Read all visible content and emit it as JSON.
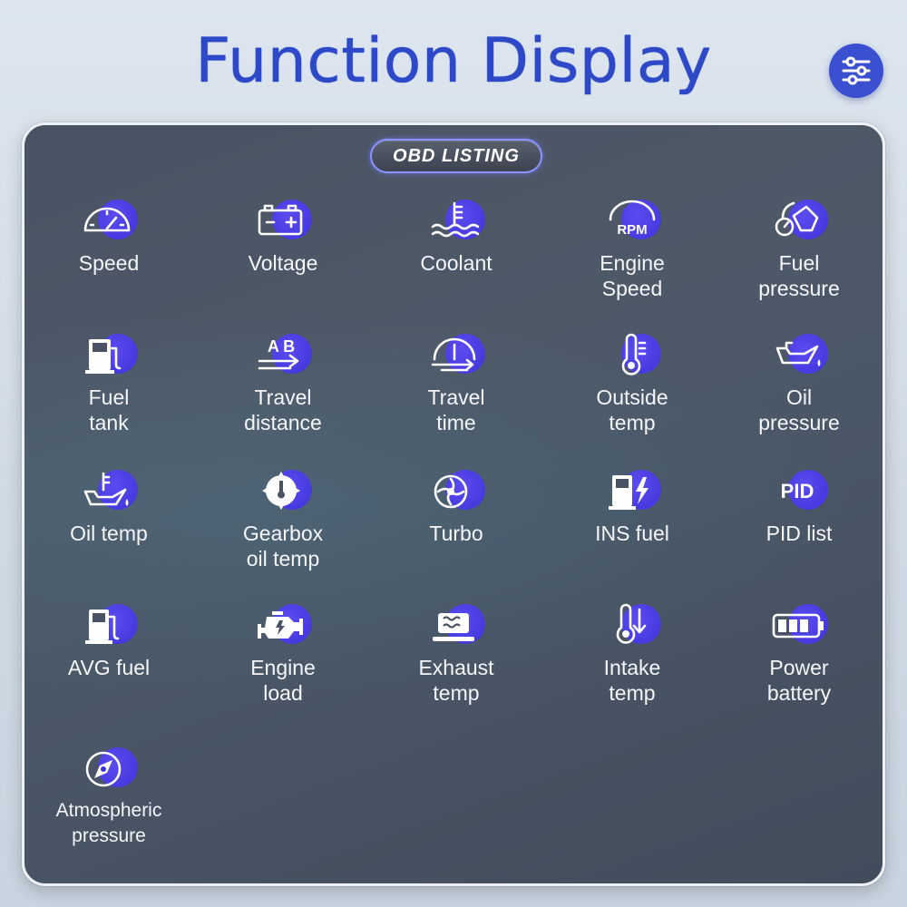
{
  "header": {
    "title": "Function Display"
  },
  "badge": {
    "label": "OBD LISTING"
  },
  "items": [
    {
      "label": "Speed",
      "icon": "speedometer-icon"
    },
    {
      "label": "Voltage",
      "icon": "battery-icon"
    },
    {
      "label": "Coolant",
      "icon": "coolant-icon"
    },
    {
      "label": "Engine\nSpeed",
      "icon": "rpm-icon"
    },
    {
      "label": "Fuel\npressure",
      "icon": "fuel-pressure-icon"
    },
    {
      "label": "Fuel\ntank",
      "icon": "fuel-pump-icon"
    },
    {
      "label": "Travel\ndistance",
      "icon": "distance-icon"
    },
    {
      "label": "Travel\ntime",
      "icon": "timer-icon"
    },
    {
      "label": "Outside\ntemp",
      "icon": "thermometer-icon"
    },
    {
      "label": "Oil\npressure",
      "icon": "oil-can-icon"
    },
    {
      "label": "Oil temp",
      "icon": "oil-temp-icon"
    },
    {
      "label": "Gearbox\noil temp",
      "icon": "gearbox-temp-icon"
    },
    {
      "label": "Turbo",
      "icon": "turbo-icon"
    },
    {
      "label": "INS fuel",
      "icon": "ins-fuel-icon"
    },
    {
      "label": "PID list",
      "icon": "pid-icon"
    },
    {
      "label": "AVG fuel",
      "icon": "avg-fuel-icon"
    },
    {
      "label": "Engine\nload",
      "icon": "engine-icon"
    },
    {
      "label": "Exhaust\ntemp",
      "icon": "exhaust-icon"
    },
    {
      "label": "Intake\ntemp",
      "icon": "intake-temp-icon"
    },
    {
      "label": "Power\nbattery",
      "icon": "power-battery-icon"
    },
    {
      "label": "Atmospheric\npressure",
      "icon": "compass-icon"
    }
  ],
  "icon_glyph": {
    "pid": "PID",
    "rpm": "RPM",
    "ab": "A B"
  },
  "colors": {
    "accent": "#3d32d8",
    "title": "#2d49c8",
    "panel": "#4a5363"
  }
}
